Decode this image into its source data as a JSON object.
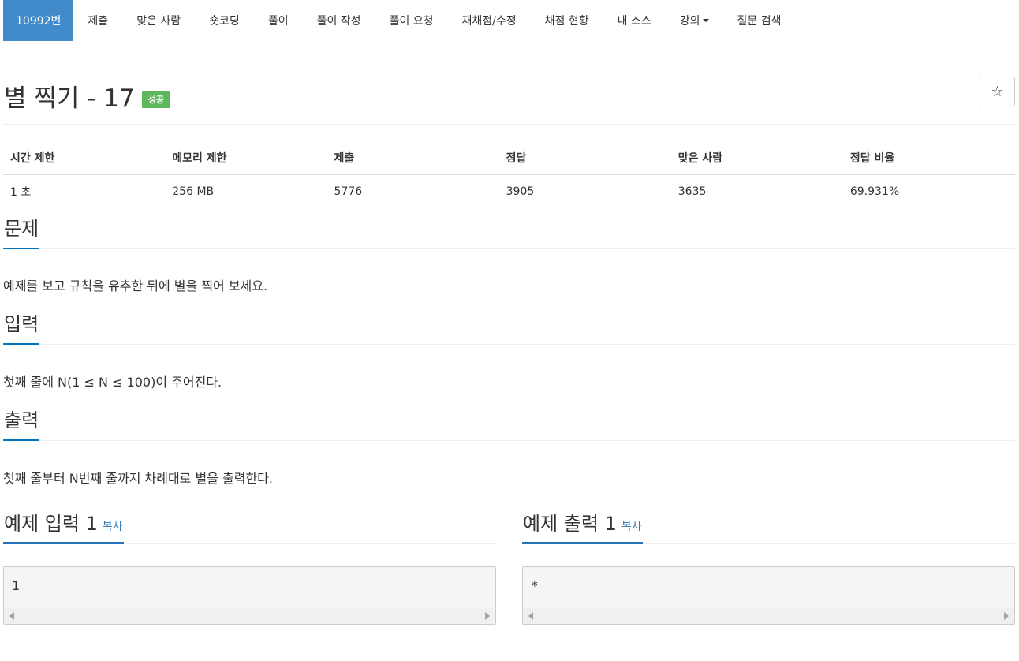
{
  "nav": {
    "items": [
      {
        "label": "10992번",
        "active": true
      },
      {
        "label": "제출"
      },
      {
        "label": "맞은 사람"
      },
      {
        "label": "숏코딩"
      },
      {
        "label": "풀이"
      },
      {
        "label": "풀이 작성"
      },
      {
        "label": "풀이 요청"
      },
      {
        "label": "재채점/수정"
      },
      {
        "label": "채점 현황"
      },
      {
        "label": "내 소스"
      },
      {
        "label": "강의"
      },
      {
        "label": "질문 검색"
      }
    ]
  },
  "problem": {
    "title": "별 찍기 - 17",
    "badge": "성공",
    "star_icon": "☆"
  },
  "info": {
    "headers": [
      "시간 제한",
      "메모리 제한",
      "제출",
      "정답",
      "맞은 사람",
      "정답 비율"
    ],
    "values": [
      "1 초",
      "256 MB",
      "5776",
      "3905",
      "3635",
      "69.931%"
    ]
  },
  "sections": {
    "problem": {
      "title": "문제",
      "body": "예제를 보고 규칙을 유추한 뒤에 별을 찍어 보세요."
    },
    "input": {
      "title": "입력",
      "body": "첫째 줄에 N(1 ≤ N ≤ 100)이 주어진다."
    },
    "output": {
      "title": "출력",
      "body": "첫째 줄부터 N번째 줄까지 차례대로 별을 출력한다."
    }
  },
  "samples": {
    "input": {
      "title": "예제 입력 1",
      "copy": "복사",
      "content": "1"
    },
    "output": {
      "title": "예제 출력 1",
      "copy": "복사",
      "content": "*"
    }
  },
  "colors": {
    "active_nav": "#428bca",
    "badge": "#5cb85c",
    "section_underline": "#0076c0",
    "link": "#337ab7"
  }
}
